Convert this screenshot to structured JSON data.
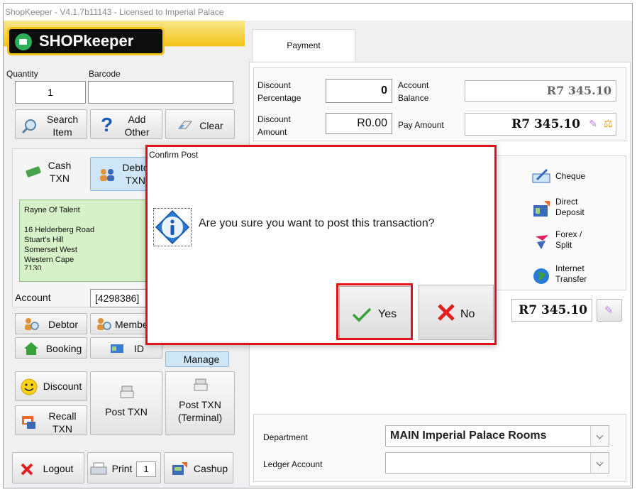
{
  "window": {
    "title": "ShopKeeper - V4.1.7b11143 - Licensed to Imperial Palace"
  },
  "logo": {
    "text": "SHOPkeeper"
  },
  "entry": {
    "quantity_label": "Quantity",
    "quantity_value": "1",
    "barcode_label": "Barcode",
    "barcode_value": ""
  },
  "top_buttons": {
    "search_line1": "Search",
    "search_line2": "Item",
    "add_line1": "Add",
    "add_line2": "Other",
    "clear": "Clear"
  },
  "txn_tabs": {
    "cash_line1": "Cash",
    "cash_line2": "TXN",
    "debtor_line1": "Debto",
    "debtor_line2": "TXN"
  },
  "address": {
    "name": "Rayne Of Talent",
    "line1": "16 Helderberg Road",
    "line2": "Stuart's Hill",
    "line3": "Somerset West",
    "line4": "Western Cape",
    "line5": "7130"
  },
  "account": {
    "label": "Account",
    "value": "[4298386]"
  },
  "mid_buttons": {
    "debtor": "Debtor",
    "member": "Membe",
    "booking": "Booking",
    "id": "ID",
    "manage": "Manage"
  },
  "action_buttons": {
    "discount": "Discount",
    "recall_line1": "Recall",
    "recall_line2": "TXN",
    "post_txn": "Post TXN",
    "post_terminal_line1": "Post TXN",
    "post_terminal_line2": "(Terminal)"
  },
  "bottom_buttons": {
    "logout": "Logout",
    "print": "Print",
    "print_count": "1",
    "cashup": "Cashup"
  },
  "payment": {
    "tab_label": "Payment",
    "discount_pct_line1": "Discount",
    "discount_pct_line2": "Percentage",
    "discount_pct_value": "0",
    "account_balance_line1": "Account",
    "account_balance_line2": "Balance",
    "account_balance_value": "R7 345.10",
    "discount_amt_line1": "Discount",
    "discount_amt_line2": "Amount",
    "discount_amt_value": "R0.00",
    "pay_amount_label": "Pay Amount",
    "pay_amount_value": "R7 345.10",
    "cheque": "Cheque",
    "direct_line1": "Direct",
    "direct_line2": "Deposit",
    "forex_line1": "Forex /",
    "forex_line2": "Split",
    "internet_line1": "Internet",
    "internet_line2": "Transfer",
    "total_value": "R7 345.10",
    "department_label": "Department",
    "department_value": "MAIN Imperial Palace Rooms",
    "ledger_label": "Ledger Account",
    "ledger_value": ""
  },
  "dialog": {
    "title": "Confirm Post",
    "message": "Are you sure you want to post this transaction?",
    "yes": "Yes",
    "no": "No"
  },
  "colors": {
    "highlight_red": "#e1121b",
    "logo_yellow": "#f3c31a",
    "address_green": "#d6f0c8"
  }
}
